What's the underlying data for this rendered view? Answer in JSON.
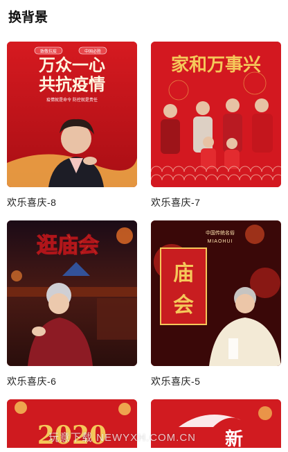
{
  "header": {
    "title": "换背景"
  },
  "cards": [
    {
      "label": "欢乐喜庆-8",
      "art_title_1": "万众一心",
      "art_title_2": "共抗疫情",
      "art_sub": "疫情就是命令 防控就是责任",
      "art_badges": [
        "致敬抗疫",
        "中国必胜"
      ]
    },
    {
      "label": "欢乐喜庆-7",
      "art_title_1": "家和万事兴"
    },
    {
      "label": "欢乐喜庆-6",
      "art_title_1": "逛庙会"
    },
    {
      "label": "欢乐喜庆-5",
      "art_title_1": "庙",
      "art_title_2": "会",
      "art_sub": "中国传统名俗",
      "art_sub_2": "MIAOHUI"
    },
    {
      "label": "",
      "art_title_1": "2020"
    },
    {
      "label": "",
      "art_title_1": "新"
    }
  ],
  "watermark": "玩意下载 NEWYXH.COM.CN",
  "colors": {
    "festive_red": "#c8141c",
    "gold": "#f5c85a"
  }
}
